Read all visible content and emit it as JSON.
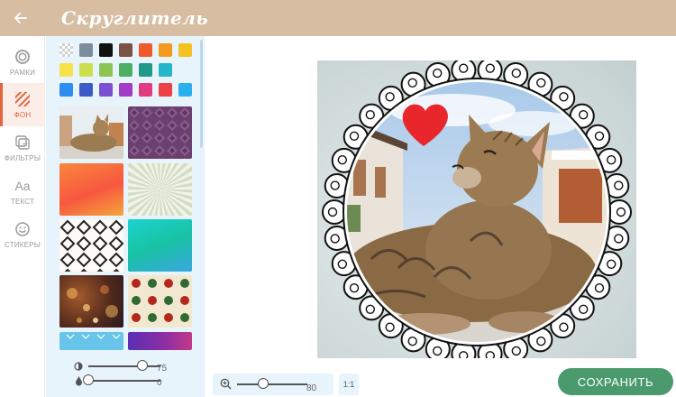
{
  "header": {
    "back_icon": "arrow-left-icon",
    "title": "Скруглитель"
  },
  "tools": [
    {
      "label": "РАМКИ",
      "icon": "circle-frame-icon"
    },
    {
      "label": "ФОН",
      "icon": "diagonal-stripes-icon",
      "active": true
    },
    {
      "label": "ФИЛЬТРЫ",
      "icon": "filters-icon"
    },
    {
      "label": "ТЕКСТ",
      "icon": "text-aa-icon"
    },
    {
      "label": "СТИКЕРЫ",
      "icon": "smiley-icon"
    }
  ],
  "background_panel": {
    "colors": [
      "transparent",
      "#7b8e9b",
      "#111111",
      "#7a5246",
      "#f05a2b",
      "#f39a1e",
      "#f6c222",
      "#f8e24a",
      "#cdde4c",
      "#8cc652",
      "#4caf62",
      "#1f9a89",
      "#22b8c9",
      "#2c8ef0",
      "#3c5bc7",
      "#7d4fd1",
      "#a23cc6",
      "#e23b7f",
      "#ef4145",
      "#2bb0ef"
    ],
    "textures": [
      {
        "name": "cat-photo-tile"
      },
      {
        "name": "purple-diamond-pattern"
      },
      {
        "name": "orange-gradient"
      },
      {
        "name": "sunburst-pattern"
      },
      {
        "name": "diamond-outline-pattern"
      },
      {
        "name": "teal-gradient"
      },
      {
        "name": "bokeh-lights"
      },
      {
        "name": "polka-dot-pattern"
      },
      {
        "name": "arrow-pattern-tile"
      },
      {
        "name": "purple-gradient"
      }
    ]
  },
  "sliders": {
    "opacity": {
      "icon": "contrast-icon",
      "value": "75",
      "fraction": 0.75
    },
    "blur": {
      "icon": "drop-icon",
      "value": "0",
      "fraction": 0
    }
  },
  "zoom": {
    "icon": "zoom-in-icon",
    "value": "80",
    "fraction": 0.37,
    "one_to_one": "1:1"
  },
  "save_button": "СОХРАНИТЬ",
  "colors": {
    "header": "#d7bea3",
    "accent": "#e0663c",
    "panel": "#e8f4fb",
    "save": "#4a9a6e"
  }
}
